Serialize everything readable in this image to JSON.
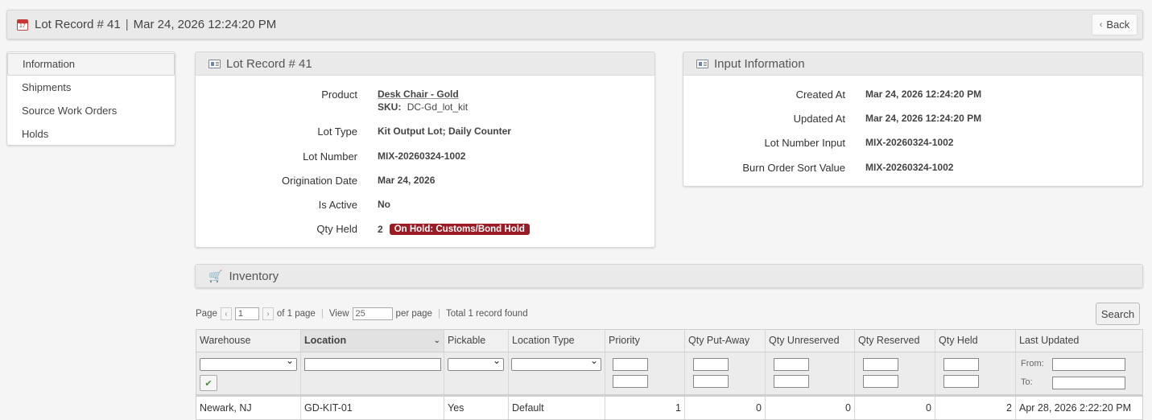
{
  "header": {
    "title": "Lot Record #  41",
    "datetime": "Mar 24, 2026 12:24:20 PM",
    "back_label": "Back"
  },
  "sidebar": {
    "items": [
      {
        "label": "Information"
      },
      {
        "label": "Shipments"
      },
      {
        "label": "Source Work Orders"
      },
      {
        "label": "Holds"
      }
    ]
  },
  "lot_panel": {
    "title": "Lot Record #  41",
    "product_label": "Product",
    "product_name": "Desk Chair - Gold",
    "sku_label": "SKU:",
    "sku_value": "DC-Gd_lot_kit",
    "lot_type_label": "Lot Type",
    "lot_type_value": "Kit Output Lot; Daily Counter",
    "lot_number_label": "Lot Number",
    "lot_number_value": "MIX-20260324-1002",
    "origination_label": "Origination Date",
    "origination_value": "Mar 24, 2026",
    "is_active_label": "Is Active",
    "is_active_value": "No",
    "qty_held_label": "Qty Held",
    "qty_held_value": "2",
    "hold_badge": "On Hold: Customs/Bond Hold"
  },
  "input_panel": {
    "title": "Input Information",
    "created_label": "Created At",
    "created_value": "Mar 24, 2026 12:24:20 PM",
    "updated_label": "Updated At",
    "updated_value": "Mar 24, 2026 12:24:20 PM",
    "lot_input_label": "Lot Number Input",
    "lot_input_value": "MIX-20260324-1002",
    "burn_label": "Burn Order Sort Value",
    "burn_value": "MIX-20260324-1002"
  },
  "inventory": {
    "title": "Inventory",
    "pager": {
      "page_label": "Page",
      "page_value": "1",
      "of_pages": "of 1 page",
      "view_label": "View",
      "view_value": "25",
      "per_page": "per page",
      "total": "Total 1 record found"
    },
    "search_label": "Search",
    "columns": [
      "Warehouse",
      "Location",
      "Pickable",
      "Location Type",
      "Priority",
      "Qty Put-Away",
      "Qty Unreserved",
      "Qty Reserved",
      "Qty Held",
      "Last Updated"
    ],
    "filter": {
      "from_label": "From:",
      "to_label": "To:"
    },
    "rows": [
      [
        "Newark, NJ",
        "GD-KIT-01",
        "Yes",
        "Default",
        "1",
        "0",
        "0",
        "0",
        "2",
        "Apr 28, 2026 2:22:20 PM"
      ]
    ]
  },
  "colors": {
    "hold_badge_bg": "#9b1c24",
    "panel_header_bg": "#eaeaea"
  }
}
